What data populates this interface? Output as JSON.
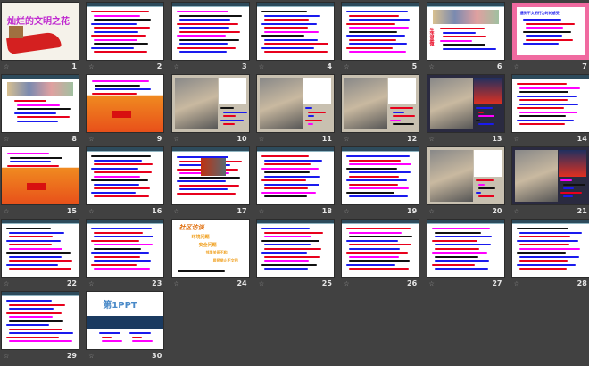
{
  "view": "slide-sorter",
  "transition_icon": "slide-transition-star-icon",
  "slides": [
    {
      "number": "1",
      "kind": "title",
      "title": "灿烂的文明之花"
    },
    {
      "number": "2",
      "kind": "text"
    },
    {
      "number": "3",
      "kind": "text"
    },
    {
      "number": "4",
      "kind": "text"
    },
    {
      "number": "5",
      "kind": "text"
    },
    {
      "number": "6",
      "kind": "image",
      "title": "生活显微"
    },
    {
      "number": "7",
      "kind": "hearts",
      "title": "遇到不文明行为时的感受"
    },
    {
      "number": "8",
      "kind": "image"
    },
    {
      "number": "9",
      "kind": "orange"
    },
    {
      "number": "10",
      "kind": "photo"
    },
    {
      "number": "11",
      "kind": "photo"
    },
    {
      "number": "12",
      "kind": "photo"
    },
    {
      "number": "13",
      "kind": "photored"
    },
    {
      "number": "14",
      "kind": "text"
    },
    {
      "number": "15",
      "kind": "orange"
    },
    {
      "number": "16",
      "kind": "text"
    },
    {
      "number": "17",
      "kind": "textphoto"
    },
    {
      "number": "18",
      "kind": "text"
    },
    {
      "number": "19",
      "kind": "text"
    },
    {
      "number": "20",
      "kind": "photo"
    },
    {
      "number": "21",
      "kind": "photored"
    },
    {
      "number": "22",
      "kind": "textblue"
    },
    {
      "number": "23",
      "kind": "text"
    },
    {
      "number": "24",
      "kind": "interview",
      "title": "社区访谈",
      "items": [
        "环境问题",
        "安全问题",
        "邻里关系不和",
        "居民举止不文明"
      ]
    },
    {
      "number": "25",
      "kind": "text"
    },
    {
      "number": "26",
      "kind": "text"
    },
    {
      "number": "27",
      "kind": "text"
    },
    {
      "number": "28",
      "kind": "text"
    },
    {
      "number": "29",
      "kind": "text"
    },
    {
      "number": "30",
      "kind": "ppt",
      "title": "第1PPT"
    }
  ]
}
